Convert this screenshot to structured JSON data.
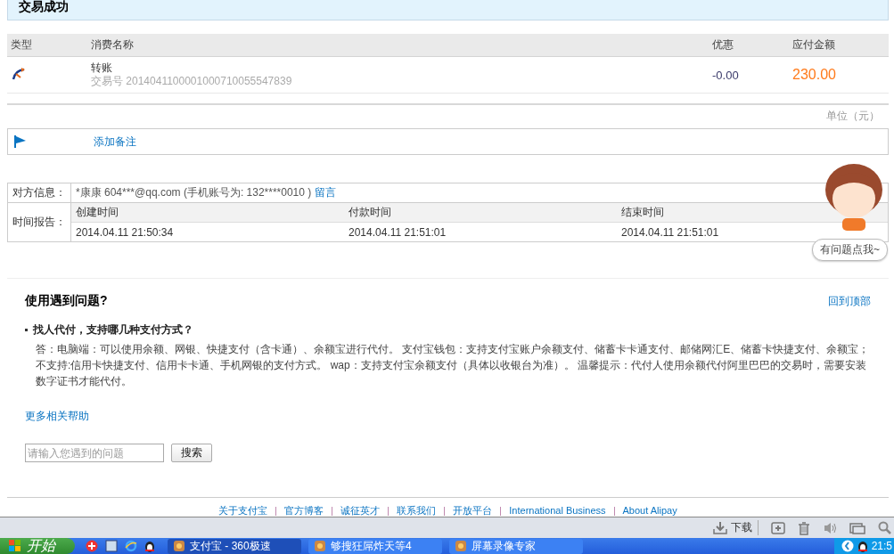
{
  "status_title": "交易成功",
  "order_table": {
    "columns": [
      "类型",
      "消费名称",
      "优惠",
      "应付金额"
    ],
    "rows": [
      {
        "name": "转账",
        "trade_no": "交易号 2014041100001000710055547839",
        "discount": "-0.00",
        "amount": "230.00"
      }
    ]
  },
  "unit": "单位（元）",
  "note_link": "添加备注",
  "counterparty": {
    "label": "对方信息：",
    "text": "*康康 604***@qq.com (手机账号为: 132****0010 )",
    "link": "留言"
  },
  "time_report": {
    "label": "时间报告：",
    "columns": [
      "创建时间",
      "付款时间",
      "结束时间"
    ],
    "values": [
      "2014.04.11 21:50:34",
      "2014.04.11 21:51:01",
      "2014.04.11 21:51:01"
    ]
  },
  "mascot": {
    "bubble": "有问题点我~"
  },
  "help": {
    "title": "使用遇到问题?",
    "back_to_top": "回到顶部",
    "question": "找人代付，支持哪几种支付方式？",
    "answer": "答：电脑端：可以使用余额、网银、快捷支付（含卡通）、余额宝进行代付。 支付宝钱包：支持支付宝账户余额支付、储蓄卡卡通支付、邮储网汇E、储蓄卡快捷支付、余额宝；不支持:信用卡快捷支付、信用卡卡通、手机网银的支付方式。 wap：支持支付宝余额支付（具体以收银台为准）。 温馨提示：代付人使用余额代付阿里巴巴的交易时，需要安装数字证书才能代付。",
    "more": "更多相关帮助",
    "search_placeholder": "请输入您遇到的问题",
    "search_button": "搜索"
  },
  "footer_links": [
    "关于支付宝",
    "官方博客",
    "诚征英才",
    "联系我们",
    "开放平台",
    "International Business",
    "About Alipay"
  ],
  "browser_status": {
    "download": "下载"
  },
  "taskbar": {
    "start": "开始",
    "tasks": [
      {
        "label": "支付宝 - 360极速",
        "selected": true
      },
      {
        "label": "够搜狂屌炸天等4",
        "selected": false
      },
      {
        "label": "屏幕录像专家",
        "selected": false
      }
    ],
    "clock": "21:5"
  }
}
